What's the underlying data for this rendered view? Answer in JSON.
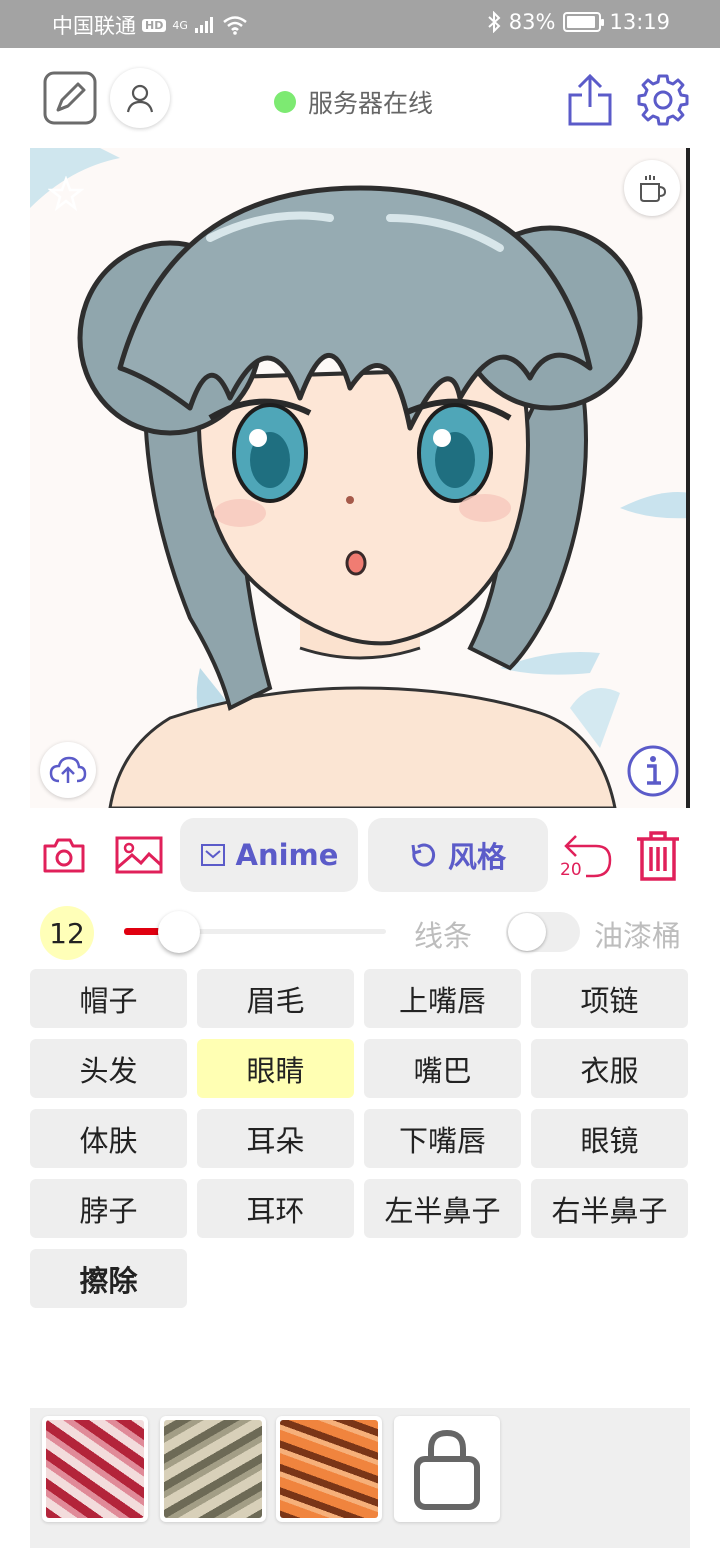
{
  "status_bar": {
    "carrier": "中国联通",
    "hd_badge": "HD",
    "network": "4G",
    "battery": "83%",
    "time": "13:19"
  },
  "header": {
    "server_status": "服务器在线",
    "server_status_color": "#7dea72"
  },
  "actions": {
    "model_label": "Anime",
    "style_label": "风格",
    "undo_count": "20",
    "accent_color": "#e0205a",
    "primary_color": "#5b5bc9"
  },
  "brush": {
    "size": "12",
    "size_level": 0.2,
    "line_label": "线条",
    "bucket_label": "油漆桶",
    "bucket_enabled": false
  },
  "parts": [
    {
      "label": "帽子"
    },
    {
      "label": "眉毛"
    },
    {
      "label": "上嘴唇"
    },
    {
      "label": "项链"
    },
    {
      "label": "头发"
    },
    {
      "label": "眼睛"
    },
    {
      "label": "嘴巴"
    },
    {
      "label": "衣服"
    },
    {
      "label": "体肤"
    },
    {
      "label": "耳朵"
    },
    {
      "label": "下嘴唇"
    },
    {
      "label": "眼镜"
    },
    {
      "label": "脖子"
    },
    {
      "label": "耳环"
    },
    {
      "label": "左半鼻子"
    },
    {
      "label": "右半鼻子"
    },
    {
      "label": "擦除"
    }
  ],
  "selected_part": "眼睛",
  "icons": {
    "top_left": [
      "sketch-icon",
      "user-icon"
    ],
    "top_right": [
      "share-icon",
      "gear-icon"
    ],
    "canvas": [
      "star-icon",
      "coffee-icon",
      "cloud-upload-icon",
      "info-icon"
    ],
    "actions": [
      "camera-icon",
      "image-icon",
      "mail-icon",
      "refresh-icon",
      "undo-icon",
      "trash-icon"
    ],
    "tray": [
      "shopping-bag-icon"
    ]
  }
}
